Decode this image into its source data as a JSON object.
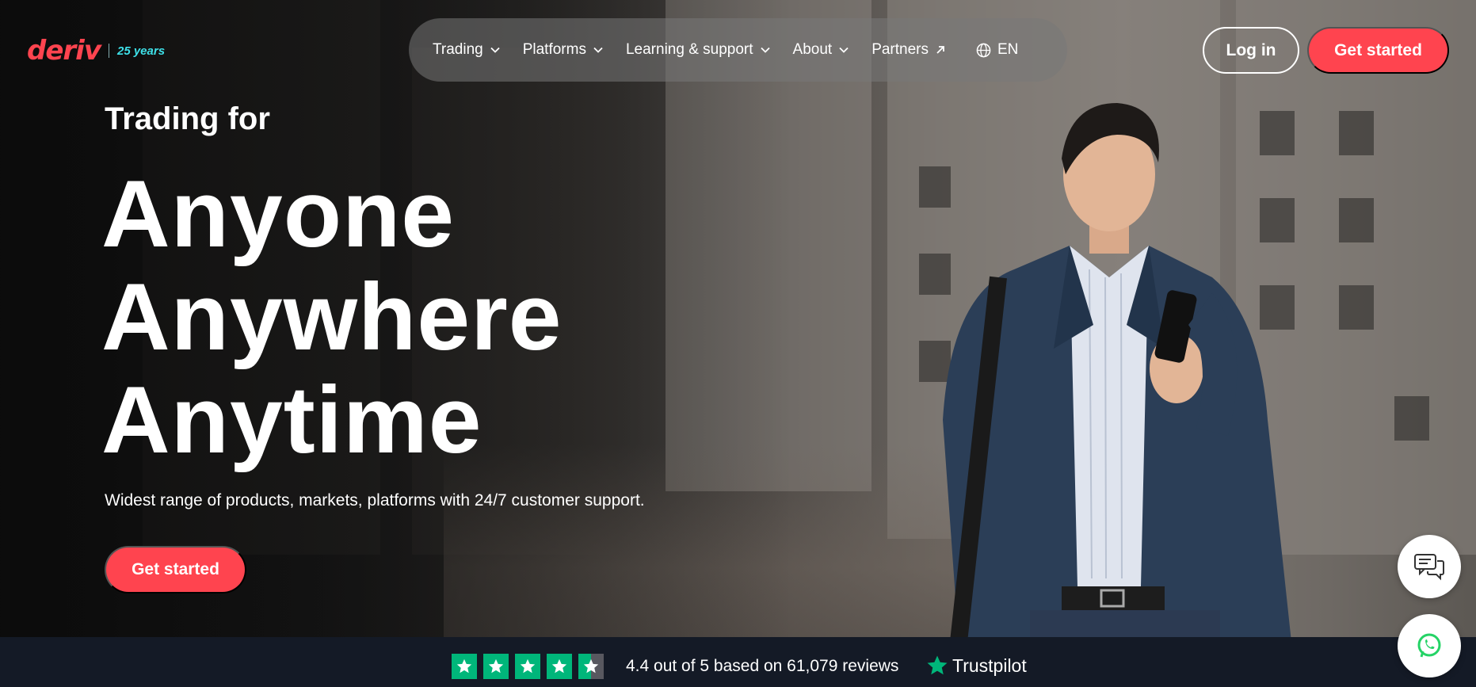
{
  "brand": {
    "logo_text": "deriv",
    "anniversary": "25 years",
    "accent": "#ff444f",
    "anniversary_color": "#3ee0e8"
  },
  "nav": {
    "items": [
      {
        "label": "Trading",
        "icon": "chevron-down-icon"
      },
      {
        "label": "Platforms",
        "icon": "chevron-down-icon"
      },
      {
        "label": "Learning & support",
        "icon": "chevron-down-icon"
      },
      {
        "label": "About",
        "icon": "chevron-down-icon"
      },
      {
        "label": "Partners",
        "icon": "arrow-up-right-icon"
      }
    ],
    "language": "EN"
  },
  "header": {
    "login_label": "Log in",
    "get_started_label": "Get started"
  },
  "hero": {
    "eyebrow": "Trading for",
    "lines": [
      "Anyone",
      "Anywhere",
      "Anytime"
    ],
    "subtext": "Widest range of products, markets, platforms with 24/7 customer support.",
    "cta_label": "Get started"
  },
  "floating": {
    "chat_icon": "chat-bubbles-icon",
    "whatsapp_icon": "whatsapp-icon"
  },
  "trustpilot": {
    "rating_text": "4.4 out of 5 based on 61,079 reviews",
    "rating": 4.4,
    "max_rating": 5,
    "brand": "Trustpilot",
    "star_color": "#00b67a"
  }
}
